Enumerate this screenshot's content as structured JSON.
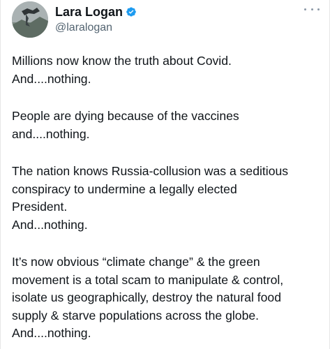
{
  "author": {
    "display_name": "Lara Logan",
    "handle": "@laralogan",
    "verified_icon": "verified-badge-icon",
    "avatar_icon": "avatar-landscape-image"
  },
  "menu": {
    "icon": "more-options-icon"
  },
  "colors": {
    "text_primary": "#0f1419",
    "text_secondary": "#536471",
    "verified_blue": "#1d9bf0",
    "background": "#ffffff"
  },
  "tweet": {
    "paragraphs": [
      {
        "lines": [
          "Millions now know the truth about Covid.",
          "And....nothing."
        ]
      },
      {
        "lines": [
          "People are dying because of the vaccines",
          "and....nothing."
        ]
      },
      {
        "lines": [
          "The nation knows Russia-collusion was a seditious",
          "conspiracy to undermine a legally elected",
          "President.",
          "And...nothing."
        ]
      },
      {
        "lines": [
          "It’s now obvious  “climate change” & the green",
          "movement is a total scam to manipulate & control,",
          "isolate us geographically, destroy the natural food",
          "supply & starve populations across the globe.",
          "And....nothing."
        ]
      }
    ]
  }
}
